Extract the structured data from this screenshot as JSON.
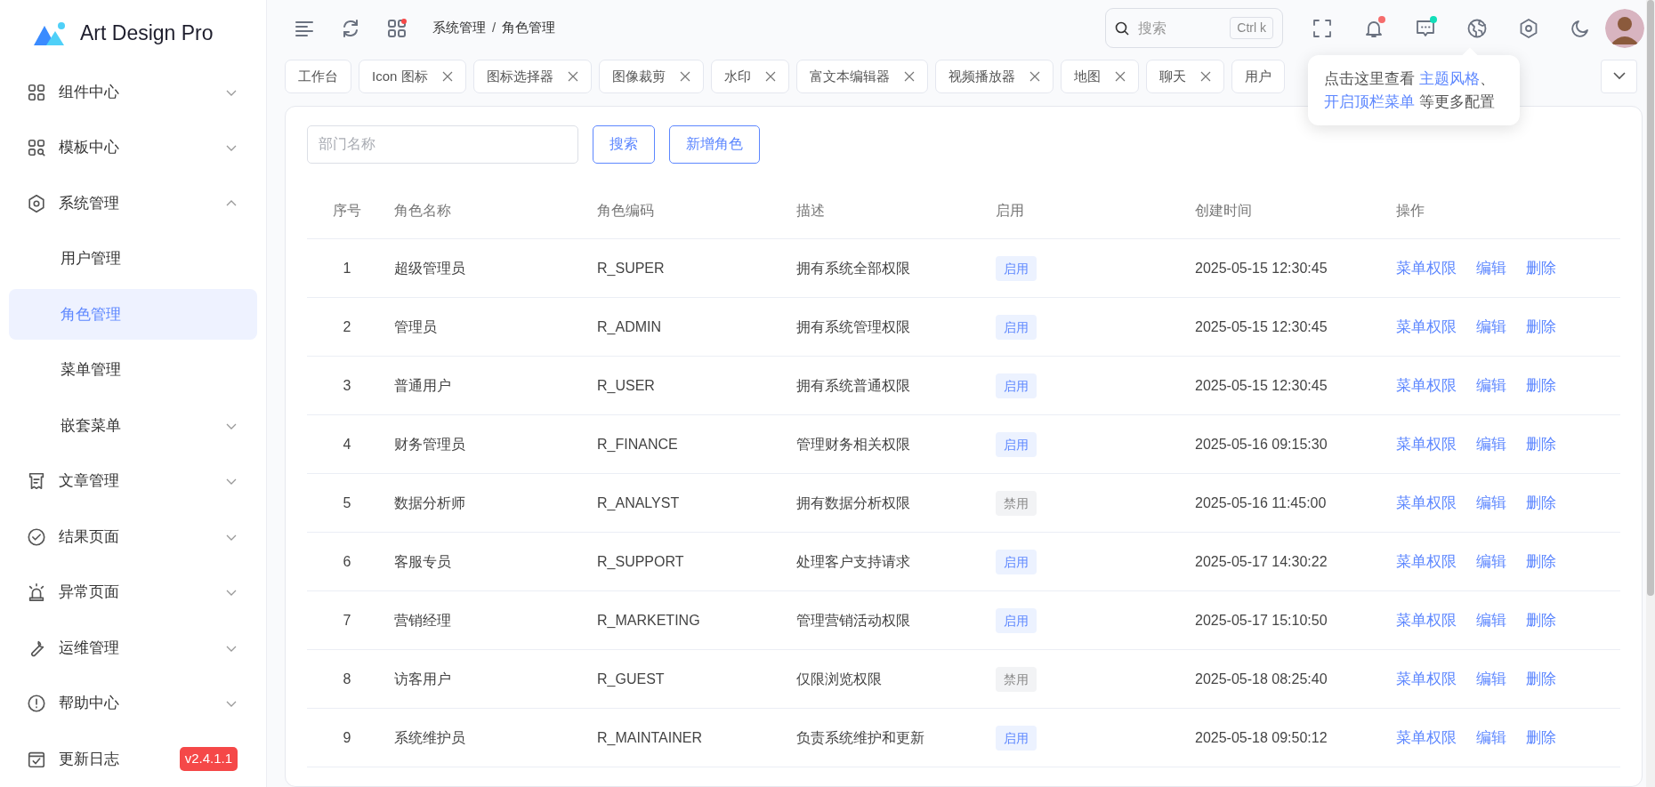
{
  "brand": {
    "name": "Art Design Pro"
  },
  "sidebar": {
    "items": [
      {
        "label": "组件中心",
        "expanded": false
      },
      {
        "label": "模板中心",
        "expanded": false
      },
      {
        "label": "系统管理",
        "expanded": true,
        "children": [
          {
            "label": "用户管理",
            "selected": false
          },
          {
            "label": "角色管理",
            "selected": true
          },
          {
            "label": "菜单管理",
            "selected": false
          },
          {
            "label": "嵌套菜单",
            "selected": false,
            "expanded": false
          }
        ]
      },
      {
        "label": "文章管理",
        "expanded": false
      },
      {
        "label": "结果页面",
        "expanded": false
      },
      {
        "label": "异常页面",
        "expanded": false
      },
      {
        "label": "运维管理",
        "expanded": false
      },
      {
        "label": "帮助中心",
        "expanded": false
      },
      {
        "label": "更新日志",
        "badge": "v2.4.1.1"
      }
    ]
  },
  "breadcrumb": [
    "系统管理",
    "/",
    "角色管理"
  ],
  "search": {
    "placeholder": "搜索",
    "shortcut": "Ctrl k"
  },
  "toolbar": [
    {
      "kind": "fullscreen"
    },
    {
      "kind": "bell",
      "color": "#f56c6c"
    },
    {
      "kind": "chat",
      "color": "#13deb9"
    },
    {
      "kind": "globe"
    },
    {
      "kind": "settings"
    },
    {
      "kind": "moon"
    }
  ],
  "tabs": [
    {
      "label": "工作台",
      "closable": false,
      "selected": false
    },
    {
      "label": "Icon 图标",
      "closable": true,
      "selected": false
    },
    {
      "label": "图标选择器",
      "closable": true,
      "selected": false
    },
    {
      "label": "图像裁剪",
      "closable": true,
      "selected": false
    },
    {
      "label": "水印",
      "closable": true,
      "selected": false
    },
    {
      "label": "富文本编辑器",
      "closable": true,
      "selected": false
    },
    {
      "label": "视频播放器",
      "closable": true,
      "selected": false
    },
    {
      "label": "地图",
      "closable": true,
      "selected": false
    },
    {
      "label": "聊天",
      "closable": true,
      "selected": false
    },
    {
      "label": "用户",
      "closable": false,
      "selected": false
    }
  ],
  "tooltip": {
    "parts": [
      {
        "kind": "text",
        "text": "点击这里查看 "
      },
      {
        "kind": "link",
        "text": "主题风格"
      },
      {
        "kind": "text",
        "text": "、 "
      },
      {
        "kind": "link",
        "text": "开启顶栏菜单"
      },
      {
        "kind": "text",
        "text": " 等更多配置"
      }
    ]
  },
  "filter": {
    "placeholder": "部门名称",
    "buttons": [
      "搜索",
      "新增角色"
    ]
  },
  "table": {
    "columns": [
      "序号",
      "角色名称",
      "角色编码",
      "描述",
      "启用",
      "创建时间",
      "操作"
    ],
    "rows": [
      {
        "index": "1",
        "name": "超级管理员",
        "code": "R_SUPER",
        "description": "拥有系统全部权限",
        "enabled": true,
        "status": "启用",
        "created": "2025-05-15 12:30:45",
        "actions": [
          "菜单权限",
          "编辑",
          "删除"
        ]
      },
      {
        "index": "2",
        "name": "管理员",
        "code": "R_ADMIN",
        "description": "拥有系统管理权限",
        "enabled": true,
        "status": "启用",
        "created": "2025-05-15 12:30:45",
        "actions": [
          "菜单权限",
          "编辑",
          "删除"
        ]
      },
      {
        "index": "3",
        "name": "普通用户",
        "code": "R_USER",
        "description": "拥有系统普通权限",
        "enabled": true,
        "status": "启用",
        "created": "2025-05-15 12:30:45",
        "actions": [
          "菜单权限",
          "编辑",
          "删除"
        ]
      },
      {
        "index": "4",
        "name": "财务管理员",
        "code": "R_FINANCE",
        "description": "管理财务相关权限",
        "enabled": true,
        "status": "启用",
        "created": "2025-05-16 09:15:30",
        "actions": [
          "菜单权限",
          "编辑",
          "删除"
        ]
      },
      {
        "index": "5",
        "name": "数据分析师",
        "code": "R_ANALYST",
        "description": "拥有数据分析权限",
        "enabled": false,
        "status": "禁用",
        "created": "2025-05-16 11:45:00",
        "actions": [
          "菜单权限",
          "编辑",
          "删除"
        ]
      },
      {
        "index": "6",
        "name": "客服专员",
        "code": "R_SUPPORT",
        "description": "处理客户支持请求",
        "enabled": true,
        "status": "启用",
        "created": "2025-05-17 14:30:22",
        "actions": [
          "菜单权限",
          "编辑",
          "删除"
        ]
      },
      {
        "index": "7",
        "name": "营销经理",
        "code": "R_MARKETING",
        "description": "管理营销活动权限",
        "enabled": true,
        "status": "启用",
        "created": "2025-05-17 15:10:50",
        "actions": [
          "菜单权限",
          "编辑",
          "删除"
        ]
      },
      {
        "index": "8",
        "name": "访客用户",
        "code": "R_GUEST",
        "description": "仅限浏览权限",
        "enabled": false,
        "status": "禁用",
        "created": "2025-05-18 08:25:40",
        "actions": [
          "菜单权限",
          "编辑",
          "删除"
        ]
      },
      {
        "index": "9",
        "name": "系统维护员",
        "code": "R_MAINTAINER",
        "description": "负责系统维护和更新",
        "enabled": true,
        "status": "启用",
        "created": "2025-05-18 09:50:12",
        "actions": [
          "菜单权限",
          "编辑",
          "删除"
        ]
      }
    ]
  }
}
